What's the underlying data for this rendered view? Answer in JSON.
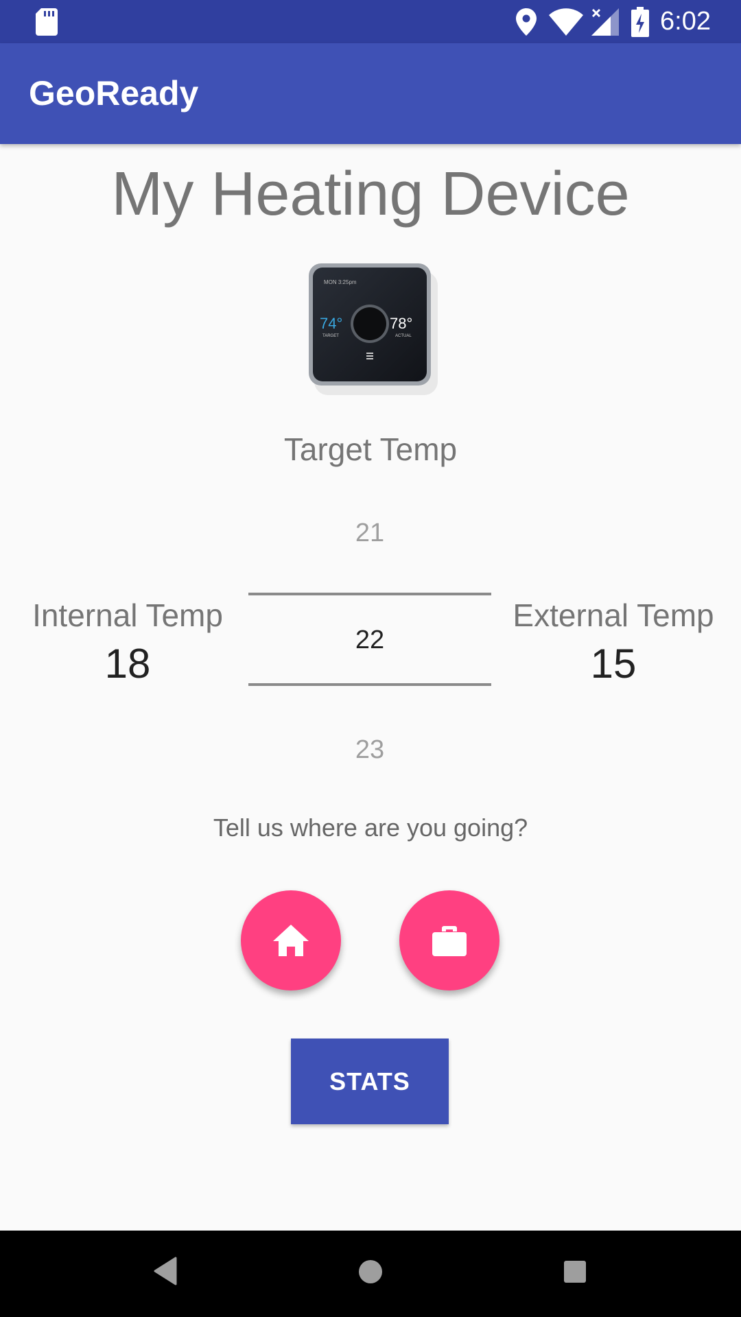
{
  "status_bar": {
    "time": "6:02",
    "icons": [
      "sd-card-icon",
      "location-icon",
      "wifi-icon",
      "signal-icon",
      "battery-charging-icon"
    ]
  },
  "app_bar": {
    "title": "GeoReady"
  },
  "page": {
    "title": "My Heating Device",
    "device_image": "thermostat-image",
    "target_label": "Target Temp"
  },
  "picker": {
    "prev": "21",
    "current": "22",
    "next": "23"
  },
  "internal": {
    "label": "Internal Temp",
    "value": "18"
  },
  "external": {
    "label": "External Temp",
    "value": "15"
  },
  "question": "Tell us where are you going?",
  "fabs": [
    {
      "icon": "home-icon"
    },
    {
      "icon": "briefcase-icon"
    }
  ],
  "stats_button": {
    "label": "STATS"
  },
  "colors": {
    "primary": "#3f51b5",
    "primary_dark": "#303f9f",
    "accent": "#ff4081"
  },
  "nav_bar": {
    "icons": [
      "back-icon",
      "home-circle-icon",
      "recents-icon"
    ]
  }
}
